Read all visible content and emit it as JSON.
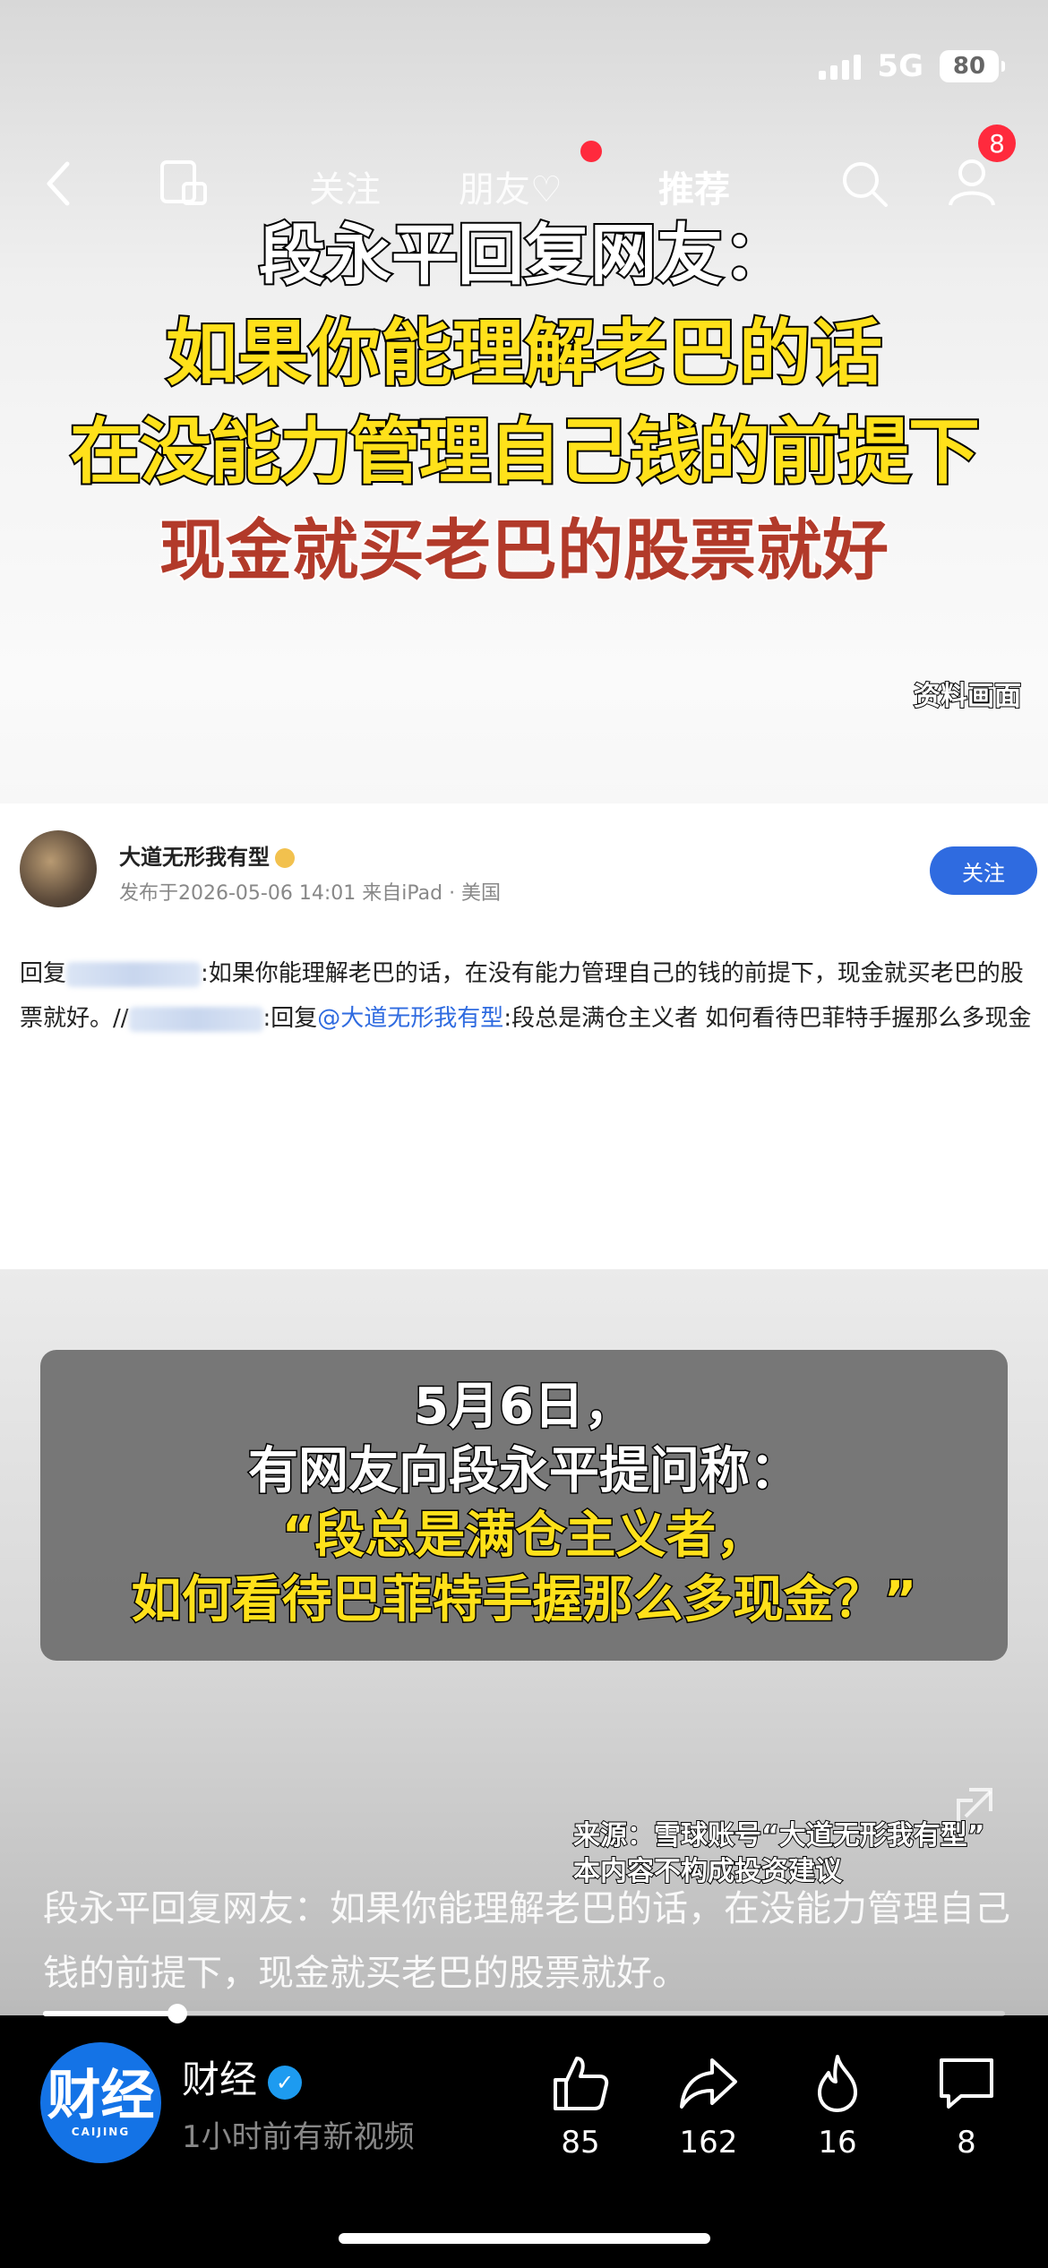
{
  "status_bar": {
    "network": "5G",
    "battery": "80"
  },
  "nav": {
    "tabs": [
      "关注",
      "朋友",
      "推荐"
    ],
    "notification_count": "8"
  },
  "headline": {
    "line1": "段永平回复网友：",
    "line2": "如果你能理解老巴的话",
    "line3": "在没能力管理自己钱的前提下",
    "line4": "现金就买老巴的股票就好",
    "source_tag": "资料画面"
  },
  "post": {
    "author": "大道无形我有型",
    "meta": "发布于2026-05-06 14:01  来自iPad · 美国",
    "follow_label": "关注",
    "text_part1": "回复",
    "text_part2": ":如果你能理解老巴的话，在没有能力管理自己的钱的前提下，现金就买老巴的股票就好。//",
    "text_part3": ":回复",
    "mention": "@大道无形我有型",
    "text_part4": ":段总是满仓主义者 如何看待巴菲特手握那么多现金"
  },
  "caption_box": {
    "line1": "5月6日，",
    "line2": "有网友向段永平提问称：",
    "line3": "“段总是满仓主义者，",
    "line4": "如何看待巴菲特手握那么多现金？”"
  },
  "source_note": {
    "line1": "来源：雪球账号“大道无形我有型”",
    "line2": "本内容不构成投资建议"
  },
  "video_description": "段永平回复网友：如果你能理解老巴的话，在没能力管理自己钱的前提下，现金就买老巴的股票就好。",
  "progress": 0.14,
  "channel": {
    "logo_text": "财经",
    "logo_sub": "CAIJING",
    "name": "财经",
    "subtitle": "1小时前有新视频"
  },
  "actions": {
    "like": "85",
    "share": "162",
    "hot": "16",
    "comment": "8"
  },
  "colors": {
    "accent_yellow": "#ffe11a",
    "headline_red": "#b23a2a",
    "link_blue": "#2f6be0",
    "badge_red": "#ff2a3d"
  }
}
